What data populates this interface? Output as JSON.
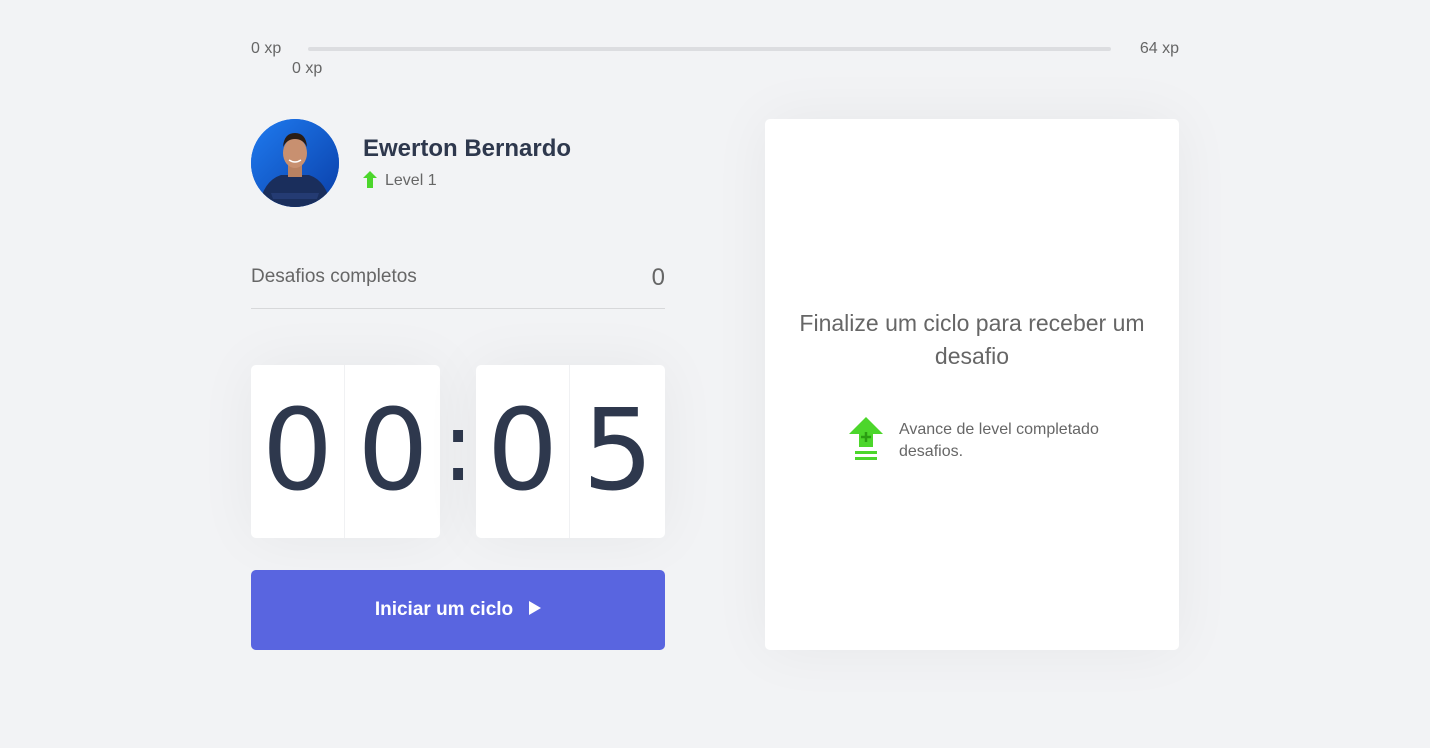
{
  "xp": {
    "min_label": "0 xp",
    "max_label": "64 xp",
    "current_label": "0 xp",
    "progress": 0
  },
  "profile": {
    "name": "Ewerton Bernardo",
    "level_label": "Level 1"
  },
  "challenges": {
    "label": "Desafios completos",
    "value": "0"
  },
  "countdown": {
    "minute_left": "0",
    "minute_right": "0",
    "separator": ":",
    "second_left": "0",
    "second_right": "5"
  },
  "action": {
    "start_label": "Iniciar um ciclo"
  },
  "challenge_card": {
    "title": "Finalize um ciclo para receber um desafio",
    "hint": "Avance de level completado desafios."
  },
  "colors": {
    "background": "#f2f3f5",
    "primary": "#5965e0",
    "success": "#4cd62b",
    "title": "#2e384d",
    "text": "#666666"
  },
  "icons": [
    "level-up-arrow-icon",
    "play-icon",
    "level-up-stack-icon"
  ]
}
